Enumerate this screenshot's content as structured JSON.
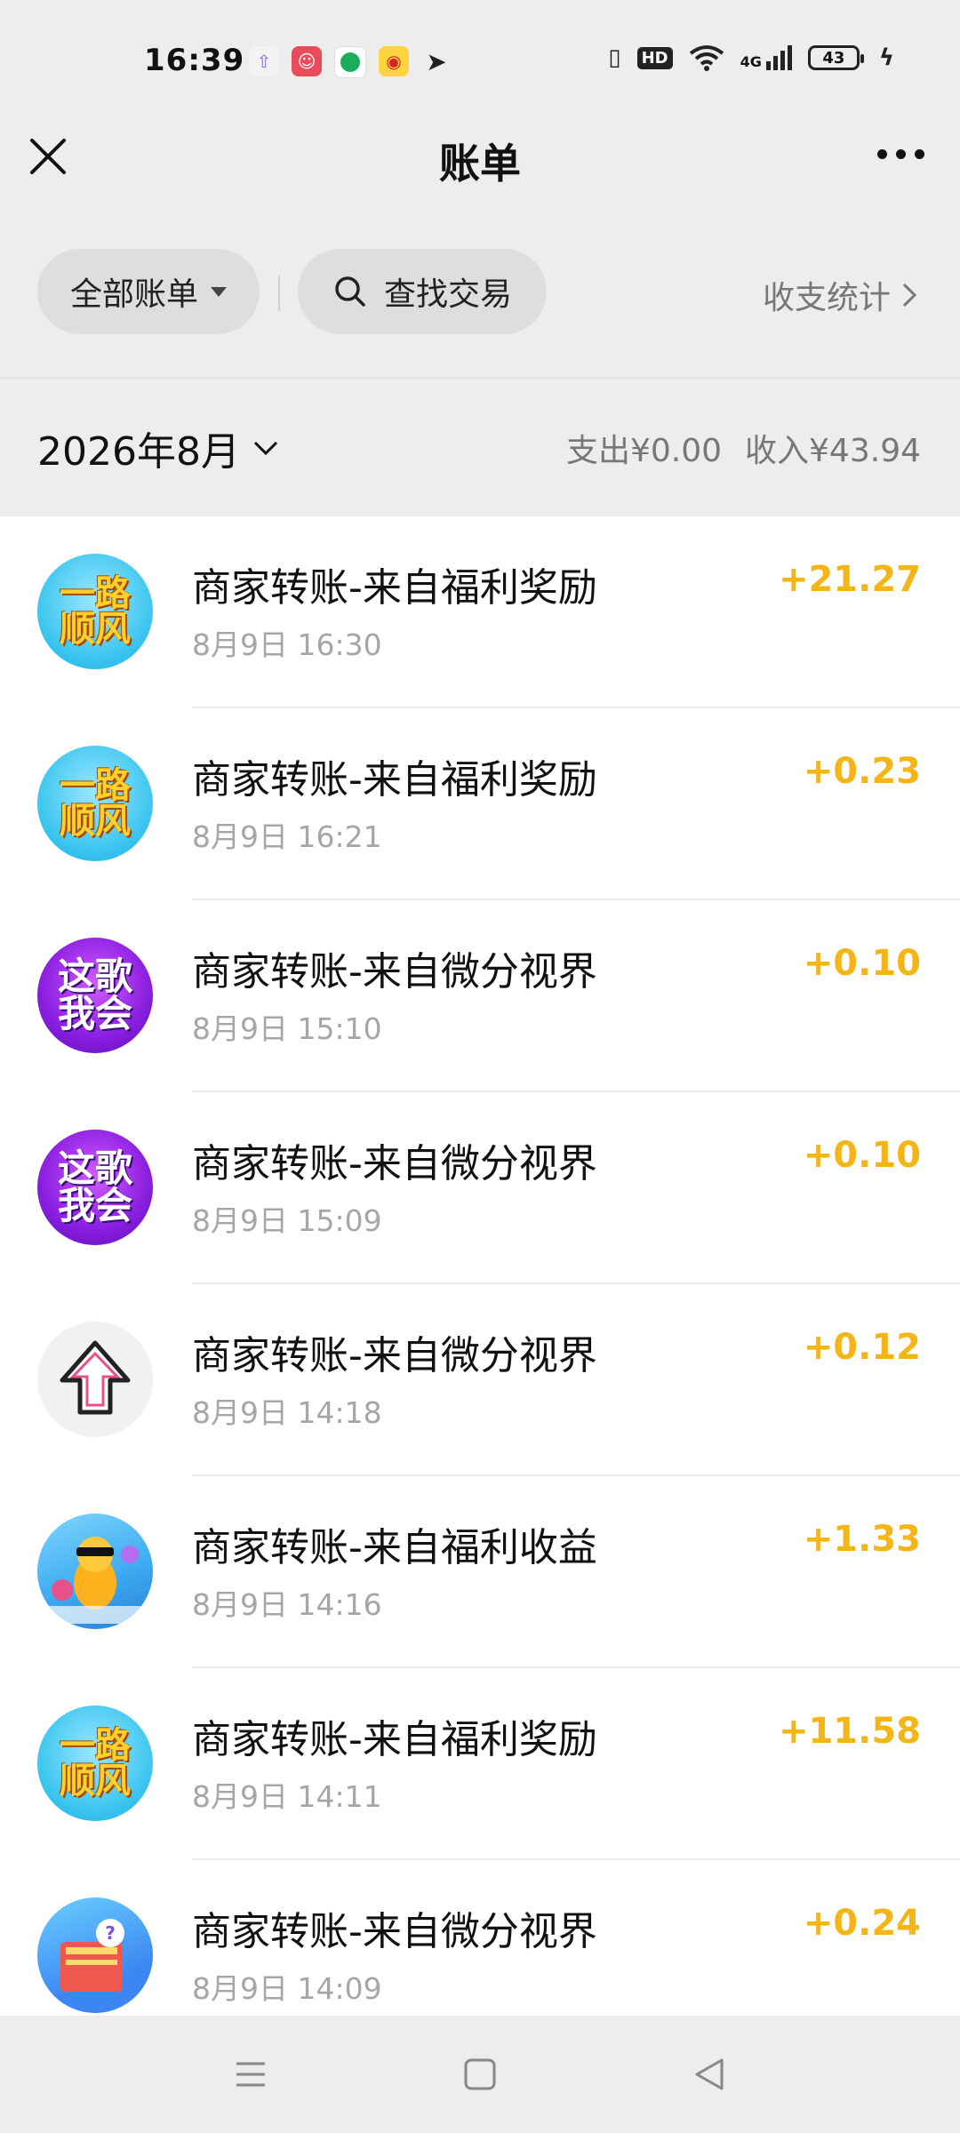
{
  "status_bar": {
    "time": "16:39",
    "battery": "43",
    "icons": [
      "upload-arrow-icon",
      "joker-app-icon",
      "chat-bubble-icon",
      "weibo-icon",
      "telegram-icon",
      "vibrate-icon",
      "hd-icon",
      "wifi-icon",
      "4g-signal-icon",
      "battery-icon",
      "charging-icon"
    ],
    "hd_label": "HD",
    "net_label": "4G"
  },
  "header": {
    "title": "账单",
    "close_icon": "close-icon",
    "more_icon": "more-icon"
  },
  "filters": {
    "all_label": "全部账单",
    "search_label": "查找交易",
    "stats_label": "收支统计"
  },
  "month_section": {
    "month": "2026年8月",
    "expense": "支出¥0.00",
    "income": "收入¥43.94"
  },
  "transactions": [
    {
      "title": "商家转账-来自福利奖励",
      "time": "8月9日 16:30",
      "amount": "+21.27",
      "avatar": "yilu",
      "avatar_line1": "一路",
      "avatar_line2": "顺风"
    },
    {
      "title": "商家转账-来自福利奖励",
      "time": "8月9日 16:21",
      "amount": "+0.23",
      "avatar": "yilu",
      "avatar_line1": "一路",
      "avatar_line2": "顺风"
    },
    {
      "title": "商家转账-来自微分视界",
      "time": "8月9日 15:10",
      "amount": "+0.10",
      "avatar": "zhege",
      "avatar_line1": "这歌",
      "avatar_line2": "我会"
    },
    {
      "title": "商家转账-来自微分视界",
      "time": "8月9日 15:09",
      "amount": "+0.10",
      "avatar": "zhege",
      "avatar_line1": "这歌",
      "avatar_line2": "我会"
    },
    {
      "title": "商家转账-来自微分视界",
      "time": "8月9日 14:18",
      "amount": "+0.12",
      "avatar": "arrow",
      "avatar_line1": "",
      "avatar_line2": ""
    },
    {
      "title": "商家转账-来自福利收益",
      "time": "8月9日 14:16",
      "amount": "+1.33",
      "avatar": "game",
      "avatar_line1": "",
      "avatar_line2": ""
    },
    {
      "title": "商家转账-来自福利奖励",
      "time": "8月9日 14:11",
      "amount": "+11.58",
      "avatar": "yilu",
      "avatar_line1": "一路",
      "avatar_line2": "顺风"
    },
    {
      "title": "商家转账-来自微分视界",
      "time": "8月9日 14:09",
      "amount": "+0.24",
      "avatar": "book",
      "avatar_line1": "",
      "avatar_line2": ""
    }
  ],
  "nav_bar": {
    "icons": [
      "menu-icon",
      "home-square-icon",
      "back-triangle-icon"
    ]
  },
  "colors": {
    "amount": "#f4b617",
    "background": "#ededed",
    "list_background": "#ffffff"
  }
}
